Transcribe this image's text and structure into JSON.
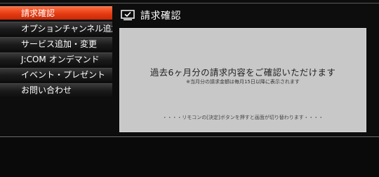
{
  "menu": {
    "items": [
      {
        "label": "請求確認",
        "active": true
      },
      {
        "label": "オプションチャンネル追加",
        "active": false
      },
      {
        "label": "サービス追加・変更",
        "active": false
      },
      {
        "label": "J:COM オンデマンド",
        "active": false
      },
      {
        "label": "イベント・プレゼント",
        "active": false
      },
      {
        "label": "お問い合わせ",
        "active": false
      }
    ]
  },
  "header": {
    "icon": "tv-check-icon",
    "title": "請求確認"
  },
  "panel": {
    "main_text": "過去6ヶ月分の請求内容をご確認いただけます",
    "note_text": "※当月分の請求金額は毎月15日以降に表示されます",
    "hint_text": "・・・・リモコンの[決定]ボタンを押すと画面が切り替わります・・・・"
  },
  "colors": {
    "accent": "#e43a12",
    "panel_bg": "#c8c8c8",
    "screen_bg": "#0d0d0d"
  }
}
